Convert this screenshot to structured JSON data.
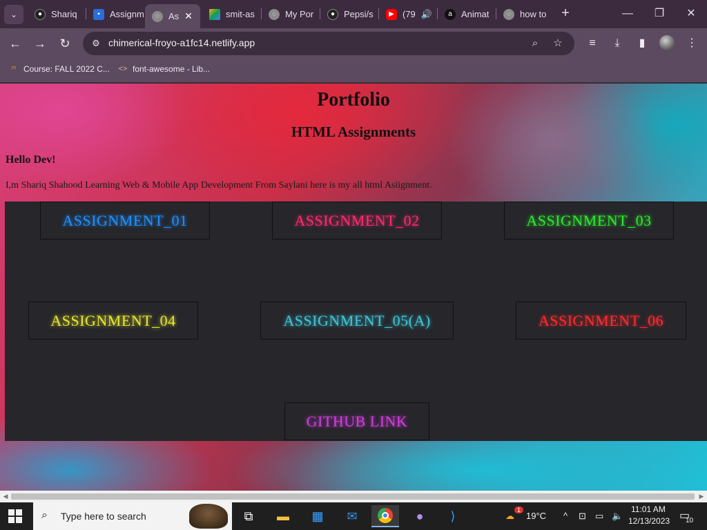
{
  "browser": {
    "tabs": [
      {
        "title": "Shariq",
        "icon": "github-icon",
        "active": false
      },
      {
        "title": "Assignm",
        "icon": "google-classroom-icon",
        "active": false
      },
      {
        "title": "As",
        "icon": "globe-icon",
        "active": true
      },
      {
        "title": "smit-as",
        "icon": "google-drive-icon",
        "active": false
      },
      {
        "title": "My Por",
        "icon": "globe-icon",
        "active": false
      },
      {
        "title": "Pepsi/s",
        "icon": "github-icon",
        "active": false
      },
      {
        "title": "(79",
        "icon": "youtube-icon",
        "active": false
      },
      {
        "title": "Animat",
        "icon": "amazon-icon",
        "active": false
      },
      {
        "title": "how to",
        "icon": "globe-icon",
        "active": false
      }
    ],
    "url": "chimerical-froyo-a1fc14.netlify.app",
    "bookmarks": [
      {
        "label": "Course: FALL 2022 C...",
        "icon": "moodle-icon"
      },
      {
        "label": "font-awesome - Lib...",
        "icon": "code-icon"
      }
    ]
  },
  "page": {
    "title": "Portfolio",
    "subtitle": "HTML Assignments",
    "greeting": "Hello Dev!",
    "intro": "I,m Shariq Shahood Learning Web & Mobile App Development From Saylani here is my all html Asiignment.",
    "buttons": [
      {
        "label": "ASSIGNMENT_01",
        "color": "#1e90ff"
      },
      {
        "label": "ASSIGNMENT_02",
        "color": "#ff2a6d"
      },
      {
        "label": "ASSIGNMENT_03",
        "color": "#2ee82e"
      },
      {
        "label": "ASSIGNMENT_04",
        "color": "#e6e62e"
      },
      {
        "label": "ASSIGNMENT_05(A)",
        "color": "#3ec7d8"
      },
      {
        "label": "ASSIGNMENT_06",
        "color": "#ff2a2a"
      },
      {
        "label": "GITHUB LINK",
        "color": "#d43be0"
      }
    ]
  },
  "taskbar": {
    "search_placeholder": "Type here to search",
    "weather": "19°C",
    "weather_badge": "1",
    "time": "11:01 AM",
    "date": "12/13/2023",
    "notifications": "10"
  }
}
